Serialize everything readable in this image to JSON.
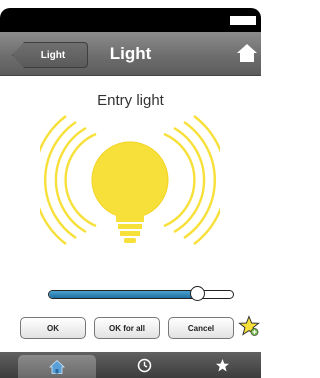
{
  "header": {
    "back_label": "Light",
    "title": "Light"
  },
  "device": {
    "name": "Entry light",
    "state": "on"
  },
  "dimmer": {
    "level_percent": 80
  },
  "actions": {
    "ok_label": "OK",
    "ok_all_label": "OK for all",
    "cancel_label": "Cancel"
  },
  "tabs": [
    {
      "name": "home",
      "icon": "home-icon",
      "active": true
    },
    {
      "name": "timer",
      "icon": "clock-icon",
      "active": false
    },
    {
      "name": "favorites",
      "icon": "star-icon",
      "active": false
    }
  ],
  "colors": {
    "bulb": "#f7e039",
    "rays": "#f7e039",
    "slider_fill": "#2a82b7",
    "header": "#6e6e6e"
  }
}
